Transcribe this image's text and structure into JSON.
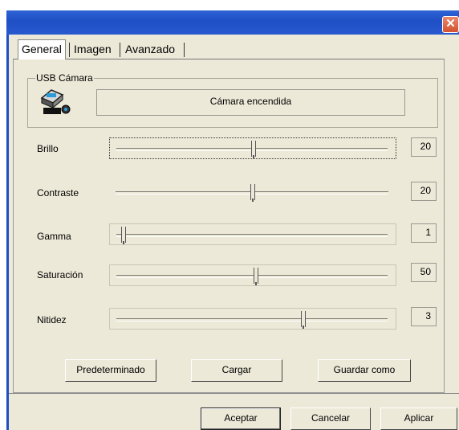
{
  "window": {
    "close_glyph": "✕"
  },
  "tabs": [
    {
      "label": "General",
      "active": true
    },
    {
      "label": "Imagen",
      "active": false
    },
    {
      "label": "Avanzado",
      "active": false
    }
  ],
  "camera_group": {
    "legend": "USB Cámara",
    "icon": "webcam-icon",
    "status": "Cámara encendida"
  },
  "sliders": [
    {
      "label": "Brillo",
      "value": "20",
      "position": 0.49
    },
    {
      "label": "Contraste",
      "value": "20",
      "position": 0.49
    },
    {
      "label": "Gamma",
      "value": "1",
      "position": 0.0
    },
    {
      "label": "Saturación",
      "value": "50",
      "position": 0.5
    },
    {
      "label": "Nitidez",
      "value": "3",
      "position": 0.68
    }
  ],
  "panel_buttons": {
    "default": "Predeterminado",
    "load": "Cargar",
    "save_as": "Guardar como"
  },
  "dialog_buttons": {
    "ok": "Aceptar",
    "cancel": "Cancelar",
    "apply": "Aplicar"
  },
  "colors": {
    "title_blue": "#1e4fc4",
    "close_red": "#d3522f",
    "dialog_bg": "#ece9d8"
  }
}
